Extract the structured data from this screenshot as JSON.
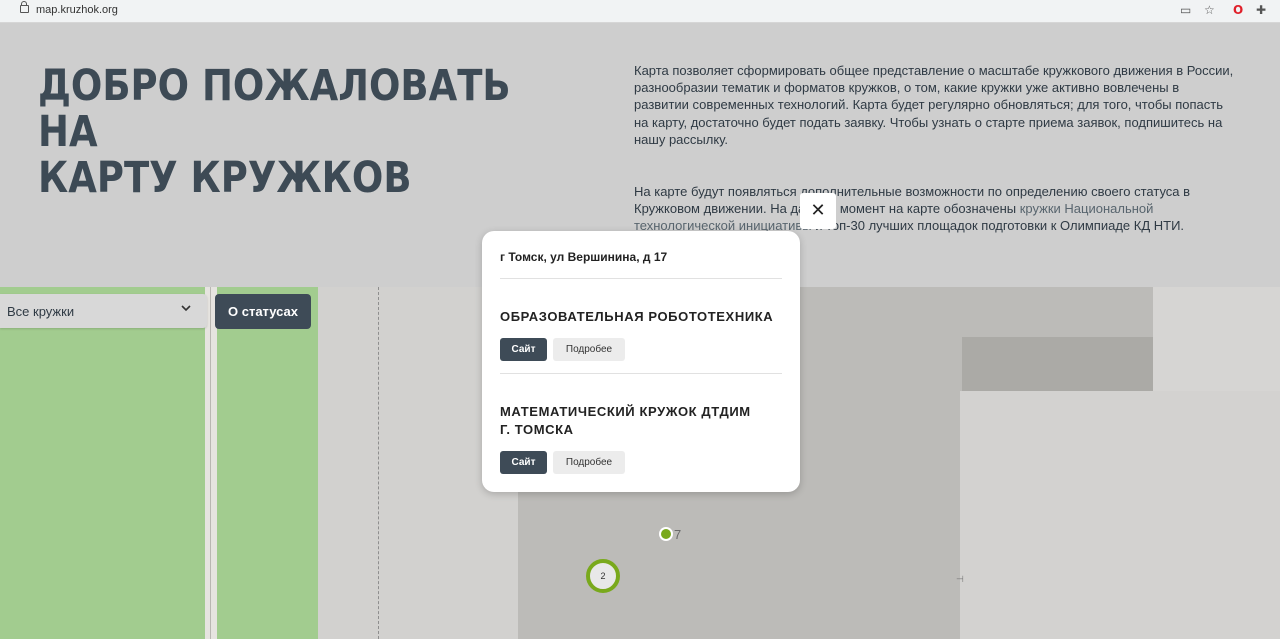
{
  "browser": {
    "url": "map.kruzhok.org",
    "icons": [
      "lock-icon",
      "install-icon",
      "star-icon",
      "opera-icon",
      "extensions-icon"
    ]
  },
  "hero": {
    "title_line1": "ДОБРО ПОЖАЛОВАТЬ НА",
    "title_line2": "КАРТУ КРУЖКОВ",
    "paragraph1": "Карта позволяет сформировать общее представление о масштабе кружкового движения в России, разнообразии тематик и форматов кружков, о том, какие кружки уже активно вовлечены в развитии современных технологий. Карта будет регулярно обновляться; для того, чтобы попасть на карту, достаточно будет подать заявку. Чтобы узнать о старте приема заявок, подпишитесь на нашу рассылку.",
    "paragraph2_text": "На карте будут появляться дополнительные возможности по определению своего статуса в Кружковом движении. На данный момент на карте обозначены ",
    "paragraph2_link": "кружки Национальной технологической инициативы",
    "paragraph2_tail": " и топ-30 лучших площадок подготовки к Олимпиаде КД НТИ."
  },
  "controls": {
    "filter_value": "Все кружки",
    "status_button": "О статусах"
  },
  "map": {
    "marker_label": "7",
    "cluster_count": "2"
  },
  "popup": {
    "close_glyph": "✕",
    "address": "г Томск, ул Вершинина, д 17",
    "clubs": [
      {
        "name": "ОБРАЗОВАТЕЛЬНАЯ РОБОТОТЕХНИКА",
        "site_label": "Сайт",
        "more_label": "Подробее"
      },
      {
        "name": "МАТЕМАТИЧЕСКИЙ КРУЖОК ДТДИМ Г. ТОМСКА",
        "site_label": "Сайт",
        "more_label": "Подробее"
      }
    ]
  },
  "colors": {
    "accent_dark": "#3e4b57",
    "marker_green": "#79a91c",
    "park_green": "#a2cc8f"
  }
}
